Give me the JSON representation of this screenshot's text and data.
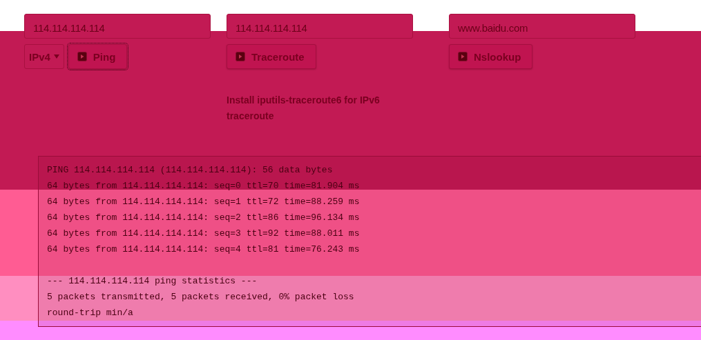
{
  "tools": [
    {
      "kind": "ping",
      "address": "114.114.114.114",
      "protocol": "IPv4",
      "button": "Ping",
      "focused": true
    },
    {
      "kind": "traceroute",
      "address": "114.114.114.114",
      "button": "Traceroute",
      "focused": false,
      "note": "Install iputils-traceroute6 for IPv6 traceroute"
    },
    {
      "kind": "nslookup",
      "address": "www.baidu.com",
      "button": "Nslookup",
      "focused": false
    }
  ],
  "output": [
    "PING 114.114.114.114 (114.114.114.114): 56 data bytes",
    "64 bytes from 114.114.114.114: seq=0 ttl=70 time=81.904 ms",
    "64 bytes from 114.114.114.114: seq=1 ttl=72 time=88.259 ms",
    "64 bytes from 114.114.114.114: seq=2 ttl=86 time=96.134 ms",
    "64 bytes from 114.114.114.114: seq=3 ttl=92 time=88.011 ms",
    "64 bytes from 114.114.114.114: seq=4 ttl=81 time=76.243 ms"
  ],
  "statistics": [
    "--- 114.114.114.114 ping statistics ---",
    "5 packets transmitted, 5 packets received, 0% packet loss",
    "round-trip min/a"
  ]
}
